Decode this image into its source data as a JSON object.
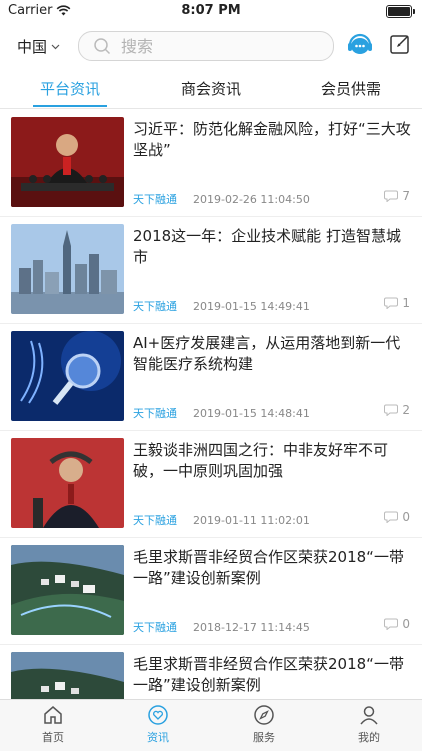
{
  "status": {
    "carrier": "Carrier",
    "time": "8:07 PM"
  },
  "nav": {
    "region": "中国",
    "search_placeholder": "搜索"
  },
  "tabs": [
    {
      "label": "平台资讯",
      "active": true
    },
    {
      "label": "商会资讯",
      "active": false
    },
    {
      "label": "会员供需",
      "active": false
    }
  ],
  "articles": [
    {
      "title": "习近平：防范化解金融风险，打好“三大攻坚战”",
      "source": "天下融通",
      "time": "2019-02-26 11:04:50",
      "comments": "7"
    },
    {
      "title": "2018这一年：企业技术赋能 打造智慧城市",
      "source": "天下融通",
      "time": "2019-01-15 14:49:41",
      "comments": "1"
    },
    {
      "title": "AI+医疗发展建言，从运用落地到新一代智能医疗系统构建",
      "source": "天下融通",
      "time": "2019-01-15 14:48:41",
      "comments": "2"
    },
    {
      "title": "王毅谈非洲四国之行：中非友好牢不可破，一中原则巩固加强",
      "source": "天下融通",
      "time": "2019-01-11 11:02:01",
      "comments": "0"
    },
    {
      "title": "毛里求斯晋非经贸合作区荣获2018“一带一路”建设创新案例",
      "source": "天下融通",
      "time": "2018-12-17 11:14:45",
      "comments": "0"
    },
    {
      "title": "毛里求斯晋非经贸合作区荣获2018“一带一路”建设创新案例",
      "source": "",
      "time": "",
      "comments": ""
    }
  ],
  "tabbar": [
    {
      "label": "首页",
      "icon": "home-icon",
      "active": false
    },
    {
      "label": "资讯",
      "icon": "news-icon",
      "active": true
    },
    {
      "label": "服务",
      "icon": "compass-icon",
      "active": false
    },
    {
      "label": "我的",
      "icon": "user-icon",
      "active": false
    }
  ],
  "colors": {
    "accent": "#2aa1e0"
  }
}
